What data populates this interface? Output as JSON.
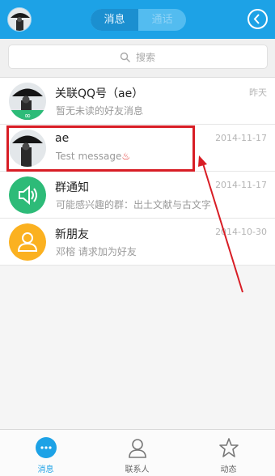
{
  "header": {
    "tabs": [
      {
        "label": "消息",
        "active": true
      },
      {
        "label": "通话",
        "active": false
      }
    ]
  },
  "search": {
    "placeholder": "搜索"
  },
  "conversations": [
    {
      "name": "关联QQ号（ae）",
      "preview": "暂无未读的好友消息",
      "time": "昨天",
      "avatar": "user-photo-icon"
    },
    {
      "name": "ae",
      "preview": "Test message",
      "time": "2014-11-17",
      "avatar": "user-photo-icon",
      "highlighted": true
    },
    {
      "name": "群通知",
      "preview": "可能感兴趣的群：出土文献与古文字",
      "time": "2014-11-17",
      "avatar": "speaker-icon"
    },
    {
      "name": "新朋友",
      "preview": "邓榕 请求加为好友",
      "time": "2014-10-30",
      "avatar": "person-icon"
    }
  ],
  "bottom_nav": [
    {
      "label": "消息",
      "icon": "chat-bubble-icon",
      "active": true
    },
    {
      "label": "联系人",
      "icon": "contacts-icon",
      "active": false
    },
    {
      "label": "动态",
      "icon": "star-icon",
      "active": false
    }
  ],
  "colors": {
    "accent": "#1da2e6",
    "highlight": "#d81d25",
    "green": "#2dbb78",
    "orange": "#fbb120"
  }
}
